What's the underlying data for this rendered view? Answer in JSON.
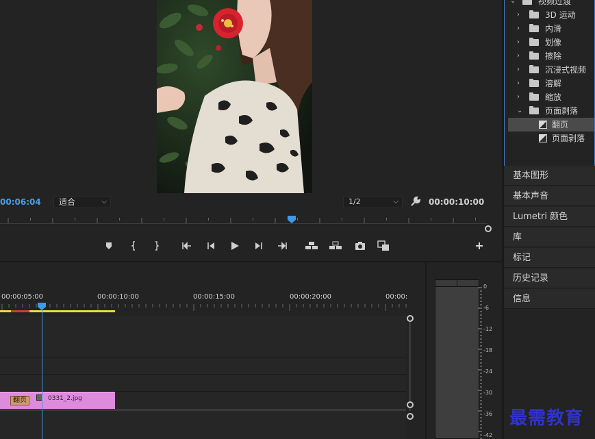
{
  "program_monitor": {
    "current_timecode": "00:06:04",
    "zoom_select": "适合",
    "resolution_select": "1/2",
    "duration_timecode": "00:00:10:00",
    "transport_controls": [
      {
        "name": "add-marker-button",
        "icon": "marker-icon"
      },
      {
        "name": "mark-in-button",
        "icon": "mark-in-icon"
      },
      {
        "name": "mark-out-button",
        "icon": "mark-out-icon"
      },
      {
        "name": "go-to-in-button",
        "icon": "go-to-in-icon"
      },
      {
        "name": "step-back-button",
        "icon": "step-back-icon"
      },
      {
        "name": "play-button",
        "icon": "play-icon"
      },
      {
        "name": "step-forward-button",
        "icon": "step-forward-icon"
      },
      {
        "name": "go-to-out-button",
        "icon": "go-to-out-icon"
      },
      {
        "name": "lift-button",
        "icon": "lift-icon"
      },
      {
        "name": "extract-button",
        "icon": "extract-icon"
      },
      {
        "name": "export-frame-button",
        "icon": "camera-icon"
      },
      {
        "name": "comparison-view-button",
        "icon": "comparison-icon"
      },
      {
        "name": "button-editor-button",
        "icon": "plus-icon"
      }
    ]
  },
  "timeline": {
    "ruler_labels": [
      "00:00:05:00",
      "00:00:10:00",
      "00:00:15:00",
      "00:00:20:00",
      "00:00:"
    ],
    "clip_name": "0331_2.jpg",
    "transition_label": "翻页"
  },
  "audio_meter": {
    "db_labels": [
      "0",
      "-6",
      "-12",
      "-18",
      "-24",
      "-30",
      "-36",
      "-42"
    ]
  },
  "effects_panel": {
    "root_folder": "视频过渡",
    "folders": [
      "3D 运动",
      "内滑",
      "划像",
      "擦除",
      "沉浸式视频",
      "溶解",
      "缩放",
      "页面剥落"
    ],
    "expanded_folder_items": [
      "翻页",
      "页面剥落"
    ],
    "selected_item": "翻页"
  },
  "side_panels": [
    "基本图形",
    "基本声音",
    "Lumetri 颜色",
    "库",
    "标记",
    "历史记录",
    "信息"
  ],
  "watermark": "最需教育",
  "colors": {
    "accent_blue": "#4a9fe8",
    "clip_pink": "#df8bdd",
    "work_area_yellow": "#e8e03a",
    "panel_border_blue": "#3d7fc4"
  }
}
